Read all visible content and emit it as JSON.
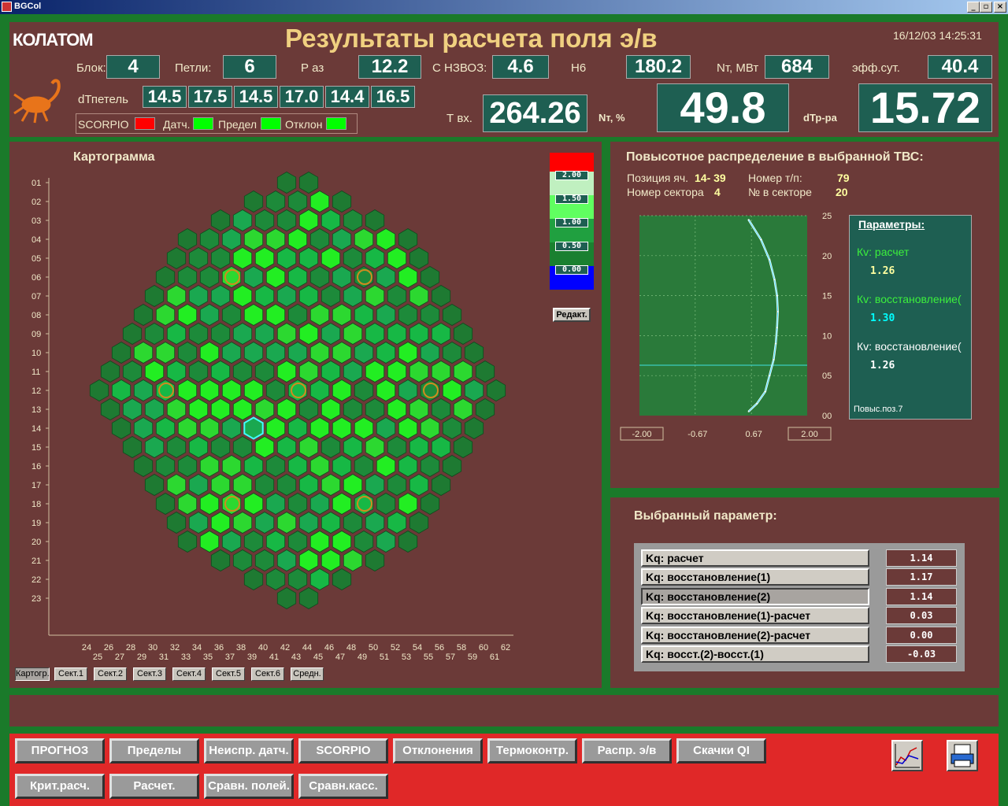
{
  "window": {
    "title": "BGCol"
  },
  "header": {
    "title": "Результаты расчета поля э/в",
    "datetime": "16/12/03 14:25:31",
    "logo": "КОЛАТОМ",
    "blok_label": "Блок:",
    "blok": "4",
    "petli_label": "Петли:",
    "petli": "6",
    "paz_label": "Р аз",
    "paz": "12.2",
    "c_label": "С НЗВОЗ:",
    "c": "4.6",
    "h6_label": "Н6",
    "h6": "180.2",
    "nt_label": "Nт, МВт",
    "nt": "684",
    "eff_label": "эфф.сут.",
    "eff": "40.4",
    "dt_label": "dТпетель",
    "dt_values": [
      "14.5",
      "17.5",
      "14.5",
      "17.0",
      "14.4",
      "16.5"
    ],
    "tvx_label": "Т вх.",
    "tvx": "264.26",
    "ntp_label": "Nт, %",
    "ntp": "49.8",
    "dtr_label": "dТр-ра",
    "dtr": "15.72",
    "scorpio_label": "SCORPIO",
    "datch_label": "Датч.",
    "predel_label": "Предел",
    "otklon_label": "Отклон",
    "indicator_colors": {
      "scorpio": "#ff0000",
      "datch": "#00ff00",
      "predel": "#00ff00",
      "otklon": "#00ff00"
    }
  },
  "kartogram": {
    "title": "Картограмма",
    "row_labels": [
      "01",
      "02",
      "03",
      "04",
      "05",
      "06",
      "07",
      "08",
      "09",
      "10",
      "11",
      "12",
      "13",
      "14",
      "15",
      "16",
      "17",
      "18",
      "19",
      "20",
      "21",
      "22",
      "23"
    ],
    "x_top": [
      "24",
      "26",
      "28",
      "30",
      "32",
      "34",
      "36",
      "38",
      "40",
      "42",
      "44",
      "46",
      "48",
      "50",
      "52",
      "54",
      "56",
      "58",
      "60",
      "62"
    ],
    "x_bottom": [
      "25",
      "27",
      "29",
      "31",
      "33",
      "35",
      "37",
      "39",
      "41",
      "43",
      "45",
      "47",
      "49",
      "51",
      "53",
      "55",
      "57",
      "59",
      "61"
    ],
    "legend": [
      "2.00",
      "1.50",
      "1.00",
      "0.50",
      "0.00"
    ],
    "edit_button": "Редакт.",
    "sectors": [
      "Картогр.",
      "Сект.1",
      "Сект.2",
      "Сект.3",
      "Сект.4",
      "Сект.5",
      "Сект.6",
      "Средн."
    ]
  },
  "distribution": {
    "title": "Повысотное распределение в выбранной ТВС:",
    "pos_label": "Позиция яч.",
    "pos": "14- 39",
    "tp_label": "Номер т/п:",
    "tp": "79",
    "sector_label": "Номер сектора",
    "sector": "4",
    "insector_label": "№ в секторе",
    "insector": "20",
    "y_ticks": [
      "25",
      "20",
      "15",
      "10",
      "05",
      "00"
    ],
    "x_ticks": [
      "-2.00",
      "-0.67",
      "0.67",
      "2.00"
    ],
    "params_title": "Параметры:",
    "kv1_label": "Кv: расчет",
    "kv1": "1.26",
    "kv2_label": "Кv: восстановление(",
    "kv2": "1.30",
    "kv3_label": "Кv: восстановление(",
    "kv3": "1.26",
    "pos_note": "Повыс.поз.7"
  },
  "chart_data": {
    "type": "line",
    "title": "",
    "xlabel": "",
    "ylabel": "",
    "xlim": [
      -2.0,
      2.0
    ],
    "ylim": [
      0,
      25
    ],
    "series": [
      {
        "x": [
          0.6,
          0.8,
          1.0,
          1.1,
          1.2,
          1.25,
          1.28,
          1.3,
          1.28,
          1.22,
          1.1,
          0.9,
          0.6
        ],
        "y": [
          0.5,
          1.5,
          3,
          5,
          7,
          9,
          11,
          13,
          15,
          17,
          19.5,
          22,
          24.5
        ]
      }
    ],
    "hline": 6.3
  },
  "selected": {
    "title": "Выбранный параметр:",
    "rows": [
      {
        "label": "Kq: расчет",
        "value": "1.14"
      },
      {
        "label": "Kq: восстановление(1)",
        "value": "1.17"
      },
      {
        "label": "Kq: восстановление(2)",
        "value": "1.14"
      },
      {
        "label": "Kq: восстановление(1)-расчет",
        "value": "0.03"
      },
      {
        "label": "Kq: восстановление(2)-расчет",
        "value": "0.00"
      },
      {
        "label": "Kq: восст.(2)-восст.(1)",
        "value": "-0.03"
      }
    ]
  },
  "toolbar": {
    "row1": [
      "ПРОГНОЗ",
      "Пределы",
      "Неиспр. датч.",
      "SCORPIO",
      "Отклонения",
      "Термоконтр.",
      "Распр. э/в",
      "Скачки QI"
    ],
    "row2": [
      "Крит.расч.",
      "Расчет.",
      "Сравн. полей.",
      "Сравн.касс."
    ]
  }
}
